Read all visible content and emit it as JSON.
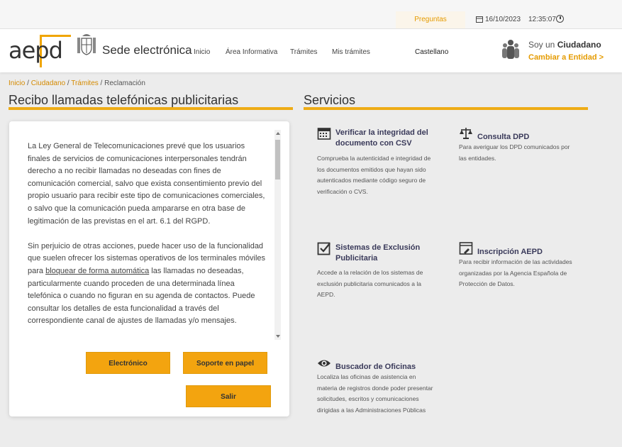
{
  "topbar": {
    "faq": "Preguntas Frecuentes",
    "date": "16/10/2023",
    "time": "12:35:07"
  },
  "header": {
    "logo_text": "aepd",
    "site_title": "Sede electrónica",
    "nav": [
      "Inicio",
      "Área Informativa",
      "Trámites",
      "Mis trámites"
    ],
    "language": "Castellano",
    "user_prefix": "Soy un",
    "user_role": "Ciudadano",
    "switch_link": "Cambiar a Entidad >"
  },
  "breadcrumb": {
    "items": [
      "Inicio",
      "Ciudadano",
      "Trámites"
    ],
    "separator": " / ",
    "current": "Reclamación"
  },
  "main": {
    "title": "Recibo llamadas telefónicas publicitarias",
    "paragraph1": "La Ley General de Telecomunicaciones prevé que los usuarios finales de servicios de comunicaciones interpersonales tendrán derecho a no recibir llamadas no deseadas con fines de comunicación comercial, salvo que exista consentimiento previo del propio usuario para recibir este tipo de comunicaciones comerciales, o salvo que la comunicación pueda ampararse en otra base de legitimación de las previstas en el art. 6.1 del RGPD.",
    "paragraph2_before": "Sin perjuicio de otras acciones, puede hacer uso de la funcionalidad que suelen ofrecer los sistemas operativos de los terminales móviles para ",
    "paragraph2_link": "bloquear de forma automática",
    "paragraph2_after": " las llamadas no deseadas, particularmente cuando proceden de una determinada línea telefónica o cuando no figuran en su agenda de contactos. Puede consultar los detalles de esta funcionalidad a través del correspondiente canal de ajustes de llamadas y/o mensajes.",
    "buttons": {
      "electronic": "Electrónico",
      "paper": "Soporte en papel",
      "exit": "Salir"
    }
  },
  "services": {
    "title": "Servicios",
    "items": [
      {
        "icon": "calendar-icon",
        "name": "Verificar la integridad del documento con CSV",
        "desc": "Comprueba la autenticidad e integridad de los documentos emitidos que hayan sido autenticados mediante código seguro de verificación o CVS."
      },
      {
        "icon": "scales-icon",
        "name": "Consulta DPD",
        "desc": "Para averiguar los DPD comunicados por las entidades."
      },
      {
        "icon": "checkbox-icon",
        "name": "Sistemas de Exclusión Publicitaria",
        "desc": "Accede a la relación de los sistemas de exclusión publicitaria comunicados a la AEPD."
      },
      {
        "icon": "form-icon",
        "name": "Inscripción AEPD",
        "desc": "Para recibir información de las actividades organizadas por la Agencia Española de Protección de Datos."
      },
      {
        "icon": "eye-icon",
        "name": "Buscador de Oficinas",
        "desc": "Localiza las oficinas de asistencia en materia de registros donde poder presentar solicitudes, escritos y comunicaciones dirigidas a las Administraciones Públicas"
      }
    ]
  },
  "colors": {
    "accent": "#eeac16",
    "button": "#f3a40f",
    "link": "#d48a00"
  }
}
